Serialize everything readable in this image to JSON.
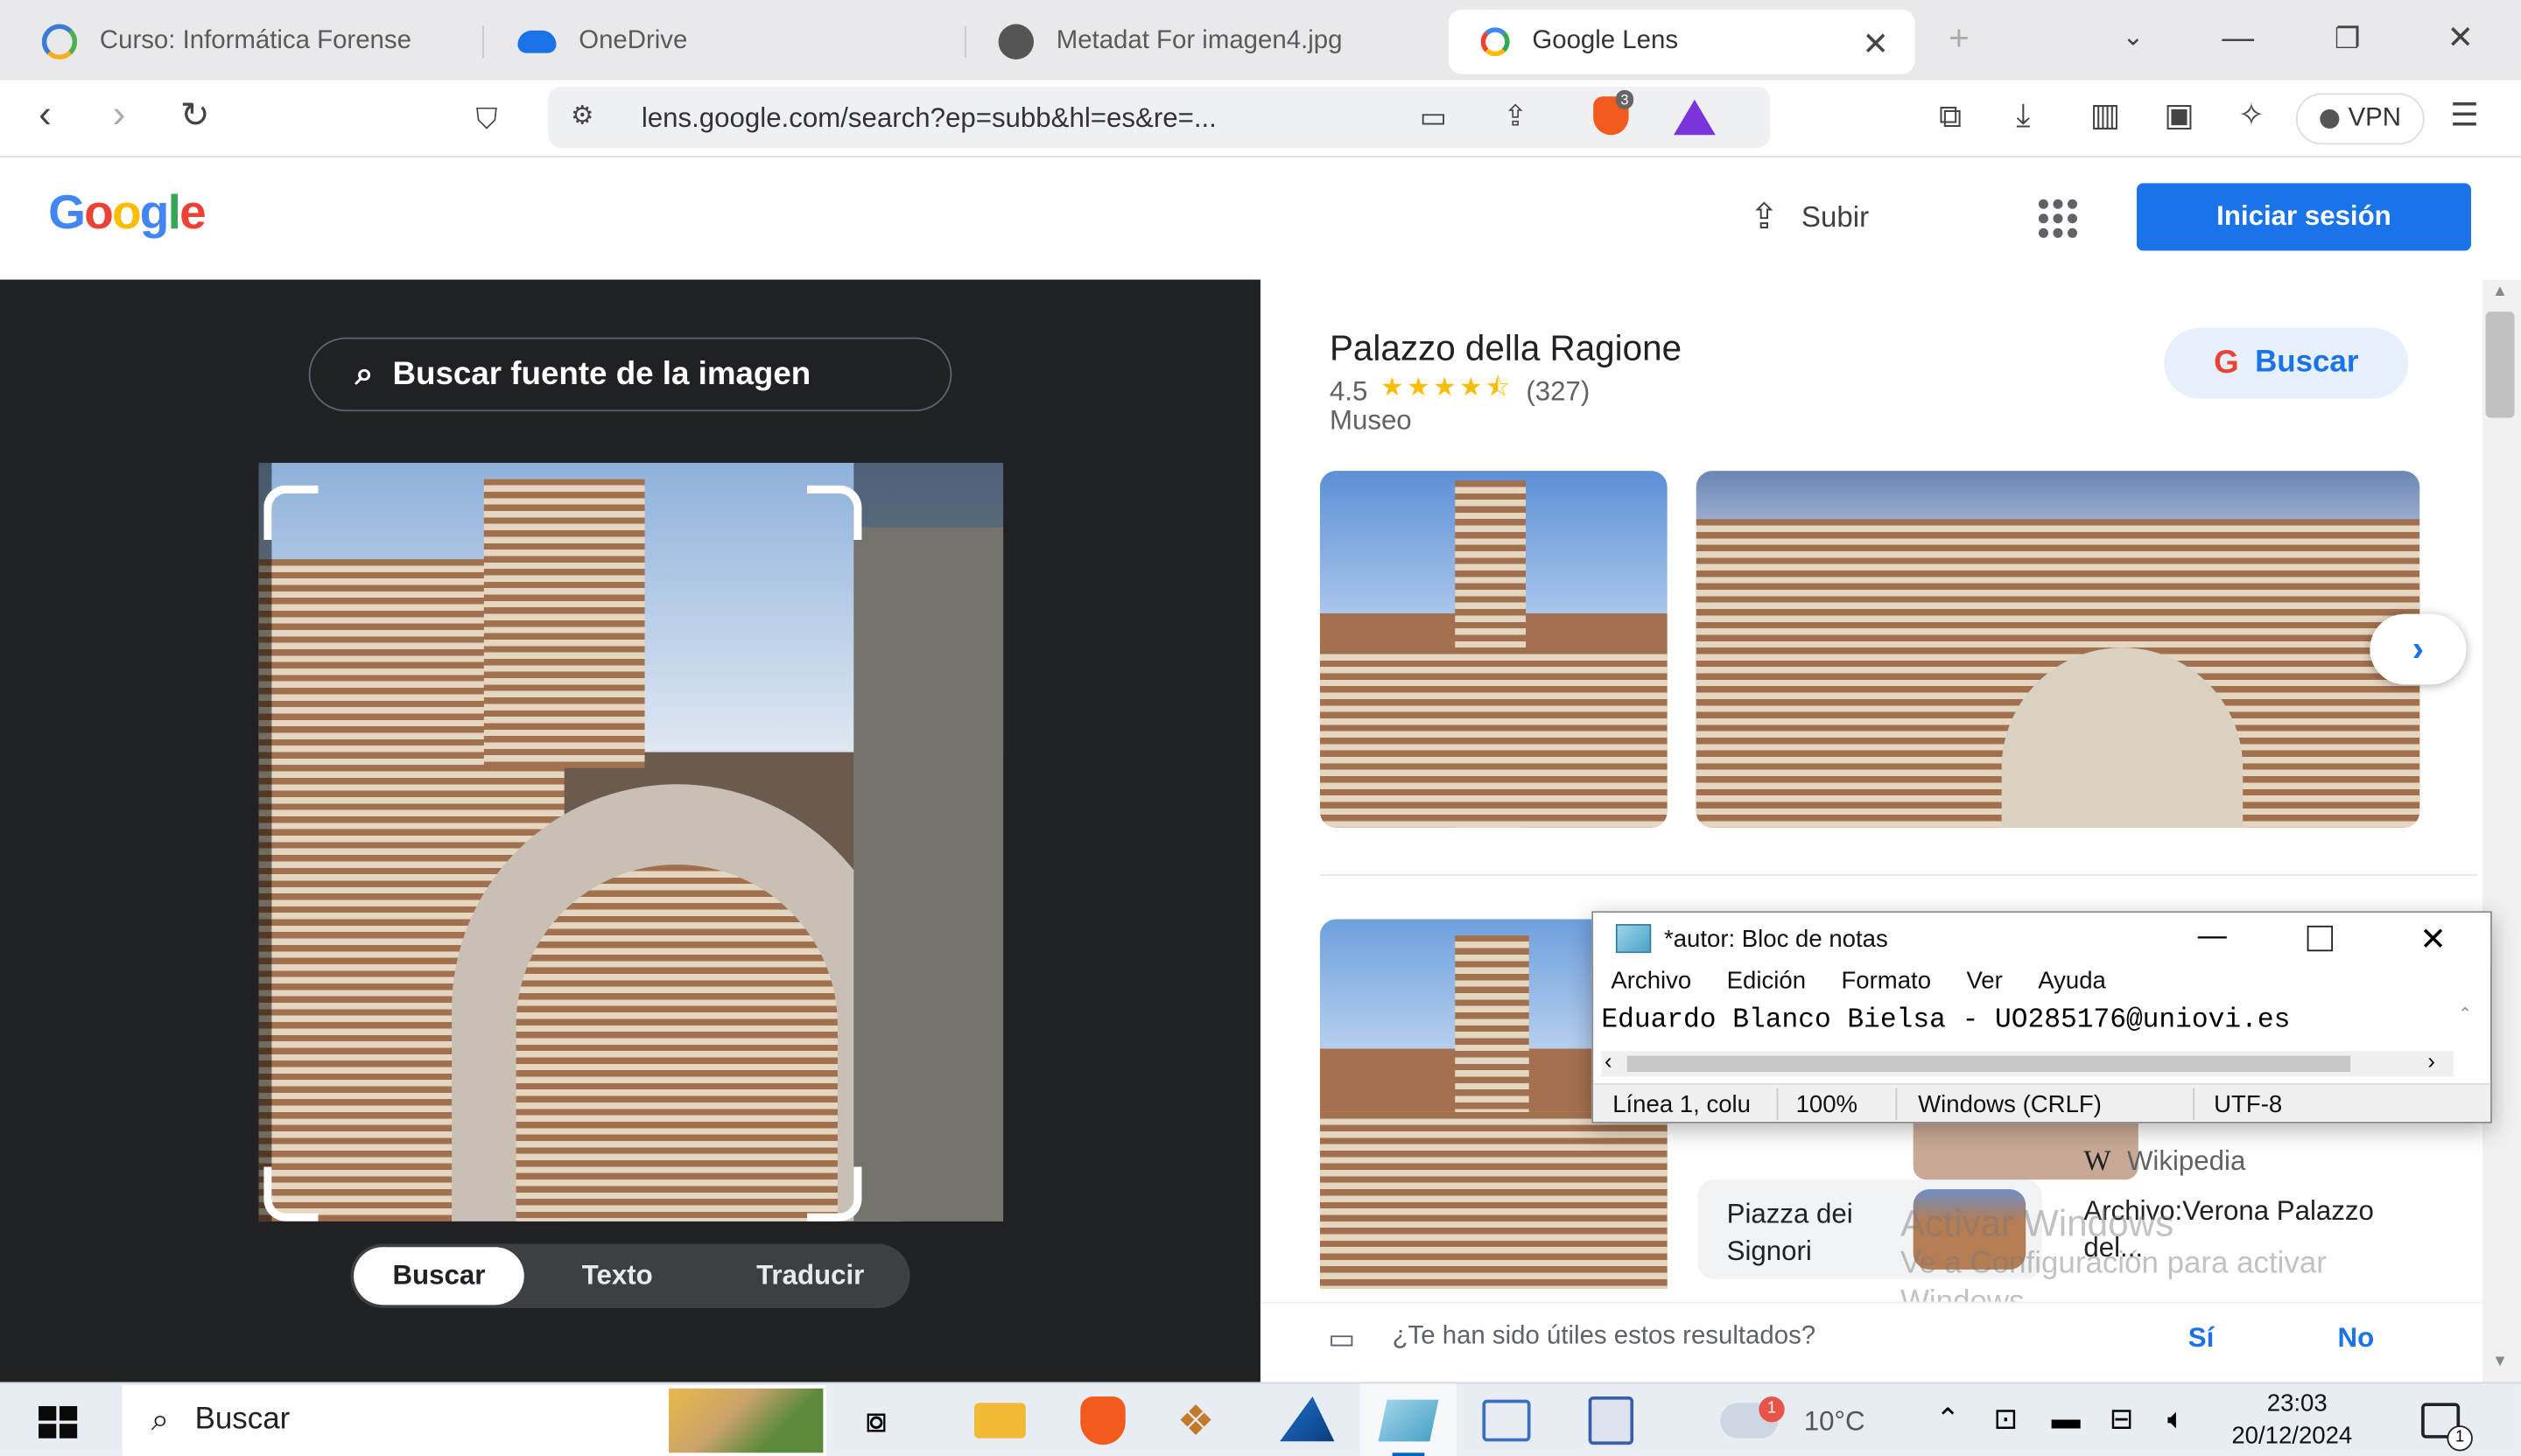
{
  "browser": {
    "tabs": [
      {
        "label": "Curso: Informática Forense"
      },
      {
        "label": "OneDrive"
      },
      {
        "label": "Metadat For imagen4.jpg"
      },
      {
        "label": "Google Lens"
      }
    ],
    "url": "lens.google.com/search?ep=subb&hl=es&re=...",
    "brave_badge": "3",
    "vpn_label": "VPN"
  },
  "google": {
    "logo": "Google",
    "upload_label": "Subir",
    "signin_label": "Iniciar sesión"
  },
  "lens": {
    "source_button": "Buscar fuente de la imagen",
    "modes": [
      "Buscar",
      "Texto",
      "Traducir"
    ]
  },
  "result": {
    "title": "Palazzo della Ragione",
    "rating": "4.5",
    "stars": 4.5,
    "reviews": "(327)",
    "category": "Museo",
    "search_button": "Buscar",
    "card1": "Piazza dei Signori",
    "source": "Wikipedia",
    "card2": "Archivo:Verona Palazzo del...",
    "feedback_question": "¿Te han sido útiles estos resultados?",
    "feedback_yes": "Sí",
    "feedback_no": "No",
    "activate_line1": "Activar Windows",
    "activate_line2": "Ve a Configuración para activar",
    "activate_line3": "Windows."
  },
  "notepad": {
    "title": "*autor: Bloc de notas",
    "menu": [
      "Archivo",
      "Edición",
      "Formato",
      "Ver",
      "Ayuda"
    ],
    "content": "Eduardo Blanco Bielsa - UO285176@uniovi.es",
    "status_pos": "Línea 1, colu",
    "status_zoom": "100%",
    "status_eol": "Windows (CRLF)",
    "status_enc": "UTF-8"
  },
  "taskbar": {
    "search_placeholder": "Buscar",
    "temperature": "10°C",
    "weather_badge": "1",
    "time": "23:03",
    "date": "20/12/2024",
    "notification_count": "1"
  },
  "colors": {
    "accent": "#1a73e8",
    "lens_bg": "#202124",
    "taskbar_bg": "#e8edf3"
  }
}
